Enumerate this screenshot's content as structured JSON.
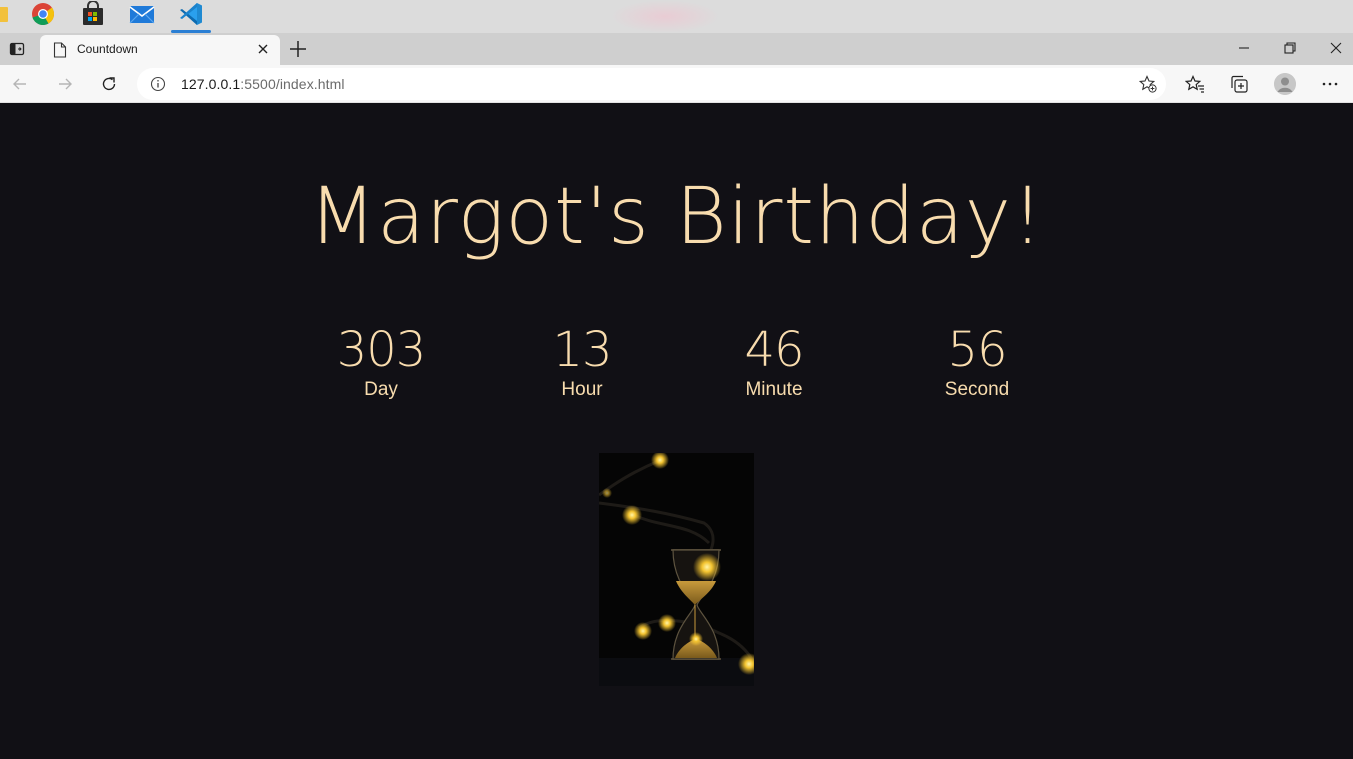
{
  "browser": {
    "tab": {
      "title": "Countdown"
    },
    "address": {
      "host": "127.0.0.1",
      "port_path": ":5500/index.html"
    }
  },
  "countdown": {
    "title": "Margot's Birthday!",
    "units": [
      {
        "value": "303",
        "label": "Day"
      },
      {
        "value": "13",
        "label": "Hour"
      },
      {
        "value": "46",
        "label": "Minute"
      },
      {
        "value": "56",
        "label": "Second"
      }
    ]
  },
  "colors": {
    "page_background": "#111015",
    "accent_text": "#f8dcae",
    "taskbar": "#dcdcdc",
    "tabbar": "#cfcfcf",
    "toolbar": "#f7f7f7"
  },
  "icons": {
    "taskbar": [
      "chrome-icon",
      "store-icon",
      "mail-icon",
      "vscode-icon"
    ],
    "toolbar": [
      "back-icon",
      "forward-icon",
      "refresh-icon",
      "info-icon",
      "add-favorite-icon",
      "favorites-icon",
      "collections-icon",
      "profile-icon",
      "more-icon"
    ]
  }
}
